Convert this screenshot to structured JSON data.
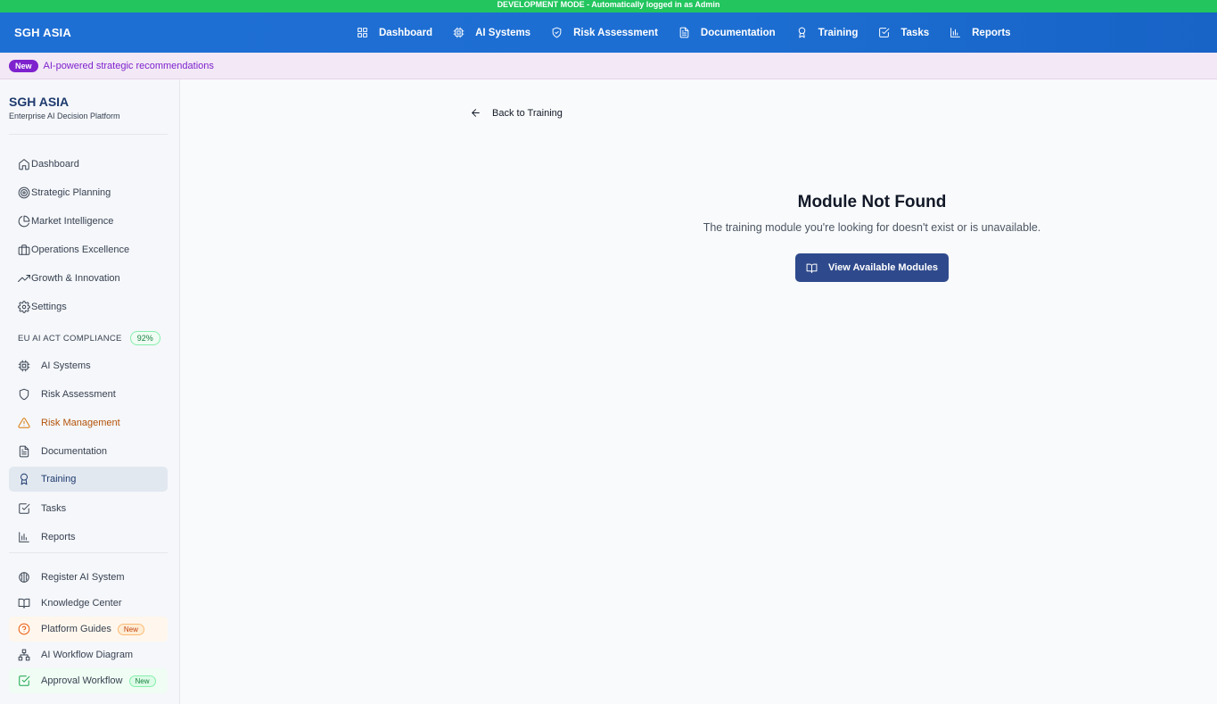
{
  "dev_banner": "DEVELOPMENT MODE - Automatically logged in as Admin",
  "topnav": {
    "brand": "SGH ASIA",
    "items": [
      {
        "label": "Dashboard",
        "icon": "grid-icon"
      },
      {
        "label": "AI Systems",
        "icon": "cpu-icon"
      },
      {
        "label": "Risk Assessment",
        "icon": "shield-check-icon"
      },
      {
        "label": "Documentation",
        "icon": "file-text-icon"
      },
      {
        "label": "Training",
        "icon": "award-icon"
      },
      {
        "label": "Tasks",
        "icon": "check-square-icon"
      },
      {
        "label": "Reports",
        "icon": "bar-chart-icon"
      }
    ]
  },
  "announcement": {
    "badge": "New",
    "text": "AI-powered strategic recommendations"
  },
  "sidebar": {
    "title": "SGH ASIA",
    "subtitle": "Enterprise AI Decision Platform",
    "main_items": [
      {
        "label": "Dashboard",
        "icon": "home-icon"
      },
      {
        "label": "Strategic Planning",
        "icon": "target-icon"
      },
      {
        "label": "Market Intelligence",
        "icon": "pie-chart-icon"
      },
      {
        "label": "Operations Excellence",
        "icon": "briefcase-icon"
      },
      {
        "label": "Growth & Innovation",
        "icon": "trending-up-icon"
      },
      {
        "label": "Settings",
        "icon": "gear-icon"
      }
    ],
    "compliance": {
      "label": "EU AI ACT COMPLIANCE",
      "percent": "92%",
      "items": [
        {
          "label": "AI Systems",
          "icon": "cpu-icon"
        },
        {
          "label": "Risk Assessment",
          "icon": "shield-icon"
        },
        {
          "label": "Risk Management",
          "icon": "warning-icon"
        },
        {
          "label": "Documentation",
          "icon": "file-text-icon"
        },
        {
          "label": "Training",
          "icon": "award-icon",
          "active": true
        },
        {
          "label": "Tasks",
          "icon": "check-square-icon"
        },
        {
          "label": "Reports",
          "icon": "bar-chart-icon"
        }
      ]
    },
    "extra_items": [
      {
        "label": "Register AI System",
        "icon": "brain-icon"
      },
      {
        "label": "Knowledge Center",
        "icon": "book-open-icon"
      },
      {
        "label": "Platform Guides",
        "icon": "help-circle-icon",
        "badge": "New"
      },
      {
        "label": "AI Workflow Diagram",
        "icon": "workflow-icon"
      },
      {
        "label": "Approval Workflow",
        "icon": "check-square-icon",
        "badge": "New"
      }
    ]
  },
  "main": {
    "back_link": "Back to Training",
    "title": "Module Not Found",
    "message": "The training module you're looking for doesn't exist or is unavailable.",
    "button_label": "View Available Modules"
  },
  "colors": {
    "dev_banner": "#22c55e",
    "topnav": "#1e6fd4",
    "announcement_bg": "#f3e8f5",
    "announcement_accent": "#7e22ce",
    "primary_button": "#2f4a8c",
    "sidebar_active": "#e2e8f0"
  }
}
